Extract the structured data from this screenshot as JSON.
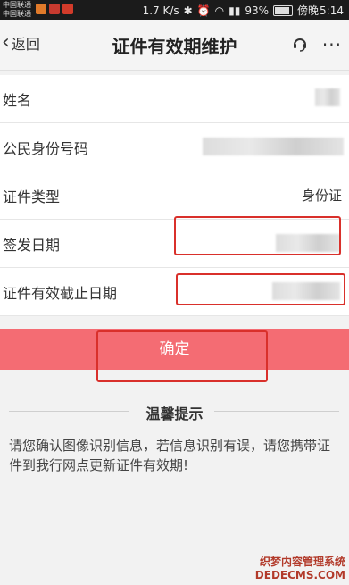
{
  "status_bar": {
    "carrier_1": "中国联通",
    "carrier_2": "中国联通",
    "speed": "1.7 K/s",
    "battery": "93%",
    "clock_prefix": "傍晚",
    "time": "5:14"
  },
  "nav": {
    "back_label": "返回",
    "title": "证件有效期维护",
    "more": "···"
  },
  "form": {
    "name_label": "姓名",
    "id_label": "公民身份号码",
    "doc_type_label": "证件类型",
    "doc_type_value": "身份证",
    "issue_date_label": "签发日期",
    "expiry_date_label": "证件有效截止日期"
  },
  "confirm_label": "确定",
  "tips": {
    "title": "温馨提示",
    "text": "请您确认图像识别信息，若信息识别有误，请您携带证件到我行网点更新证件有效期!"
  },
  "watermark": {
    "line1": "织梦内容管理系统",
    "line2": "DEDECMS.COM"
  },
  "colors": {
    "confirm_bg": "#f46c73",
    "annotation_red": "#d9302b"
  }
}
